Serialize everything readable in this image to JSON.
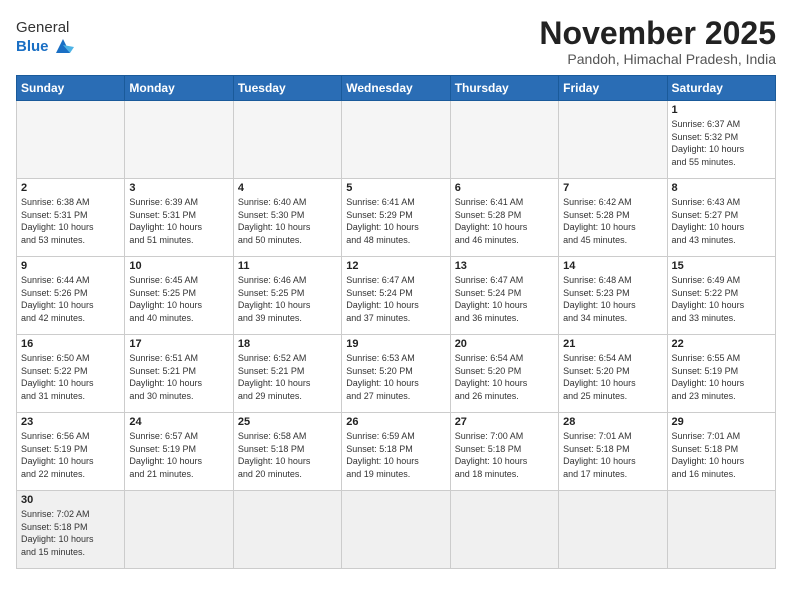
{
  "logo": {
    "text_general": "General",
    "text_blue": "Blue"
  },
  "title": "November 2025",
  "subtitle": "Pandoh, Himachal Pradesh, India",
  "days_of_week": [
    "Sunday",
    "Monday",
    "Tuesday",
    "Wednesday",
    "Thursday",
    "Friday",
    "Saturday"
  ],
  "weeks": [
    [
      {
        "day": "",
        "info": ""
      },
      {
        "day": "",
        "info": ""
      },
      {
        "day": "",
        "info": ""
      },
      {
        "day": "",
        "info": ""
      },
      {
        "day": "",
        "info": ""
      },
      {
        "day": "",
        "info": ""
      },
      {
        "day": "1",
        "info": "Sunrise: 6:37 AM\nSunset: 5:32 PM\nDaylight: 10 hours\nand 55 minutes."
      }
    ],
    [
      {
        "day": "2",
        "info": "Sunrise: 6:38 AM\nSunset: 5:31 PM\nDaylight: 10 hours\nand 53 minutes."
      },
      {
        "day": "3",
        "info": "Sunrise: 6:39 AM\nSunset: 5:31 PM\nDaylight: 10 hours\nand 51 minutes."
      },
      {
        "day": "4",
        "info": "Sunrise: 6:40 AM\nSunset: 5:30 PM\nDaylight: 10 hours\nand 50 minutes."
      },
      {
        "day": "5",
        "info": "Sunrise: 6:41 AM\nSunset: 5:29 PM\nDaylight: 10 hours\nand 48 minutes."
      },
      {
        "day": "6",
        "info": "Sunrise: 6:41 AM\nSunset: 5:28 PM\nDaylight: 10 hours\nand 46 minutes."
      },
      {
        "day": "7",
        "info": "Sunrise: 6:42 AM\nSunset: 5:28 PM\nDaylight: 10 hours\nand 45 minutes."
      },
      {
        "day": "8",
        "info": "Sunrise: 6:43 AM\nSunset: 5:27 PM\nDaylight: 10 hours\nand 43 minutes."
      }
    ],
    [
      {
        "day": "9",
        "info": "Sunrise: 6:44 AM\nSunset: 5:26 PM\nDaylight: 10 hours\nand 42 minutes."
      },
      {
        "day": "10",
        "info": "Sunrise: 6:45 AM\nSunset: 5:25 PM\nDaylight: 10 hours\nand 40 minutes."
      },
      {
        "day": "11",
        "info": "Sunrise: 6:46 AM\nSunset: 5:25 PM\nDaylight: 10 hours\nand 39 minutes."
      },
      {
        "day": "12",
        "info": "Sunrise: 6:47 AM\nSunset: 5:24 PM\nDaylight: 10 hours\nand 37 minutes."
      },
      {
        "day": "13",
        "info": "Sunrise: 6:47 AM\nSunset: 5:24 PM\nDaylight: 10 hours\nand 36 minutes."
      },
      {
        "day": "14",
        "info": "Sunrise: 6:48 AM\nSunset: 5:23 PM\nDaylight: 10 hours\nand 34 minutes."
      },
      {
        "day": "15",
        "info": "Sunrise: 6:49 AM\nSunset: 5:22 PM\nDaylight: 10 hours\nand 33 minutes."
      }
    ],
    [
      {
        "day": "16",
        "info": "Sunrise: 6:50 AM\nSunset: 5:22 PM\nDaylight: 10 hours\nand 31 minutes."
      },
      {
        "day": "17",
        "info": "Sunrise: 6:51 AM\nSunset: 5:21 PM\nDaylight: 10 hours\nand 30 minutes."
      },
      {
        "day": "18",
        "info": "Sunrise: 6:52 AM\nSunset: 5:21 PM\nDaylight: 10 hours\nand 29 minutes."
      },
      {
        "day": "19",
        "info": "Sunrise: 6:53 AM\nSunset: 5:20 PM\nDaylight: 10 hours\nand 27 minutes."
      },
      {
        "day": "20",
        "info": "Sunrise: 6:54 AM\nSunset: 5:20 PM\nDaylight: 10 hours\nand 26 minutes."
      },
      {
        "day": "21",
        "info": "Sunrise: 6:54 AM\nSunset: 5:20 PM\nDaylight: 10 hours\nand 25 minutes."
      },
      {
        "day": "22",
        "info": "Sunrise: 6:55 AM\nSunset: 5:19 PM\nDaylight: 10 hours\nand 23 minutes."
      }
    ],
    [
      {
        "day": "23",
        "info": "Sunrise: 6:56 AM\nSunset: 5:19 PM\nDaylight: 10 hours\nand 22 minutes."
      },
      {
        "day": "24",
        "info": "Sunrise: 6:57 AM\nSunset: 5:19 PM\nDaylight: 10 hours\nand 21 minutes."
      },
      {
        "day": "25",
        "info": "Sunrise: 6:58 AM\nSunset: 5:18 PM\nDaylight: 10 hours\nand 20 minutes."
      },
      {
        "day": "26",
        "info": "Sunrise: 6:59 AM\nSunset: 5:18 PM\nDaylight: 10 hours\nand 19 minutes."
      },
      {
        "day": "27",
        "info": "Sunrise: 7:00 AM\nSunset: 5:18 PM\nDaylight: 10 hours\nand 18 minutes."
      },
      {
        "day": "28",
        "info": "Sunrise: 7:01 AM\nSunset: 5:18 PM\nDaylight: 10 hours\nand 17 minutes."
      },
      {
        "day": "29",
        "info": "Sunrise: 7:01 AM\nSunset: 5:18 PM\nDaylight: 10 hours\nand 16 minutes."
      }
    ],
    [
      {
        "day": "30",
        "info": "Sunrise: 7:02 AM\nSunset: 5:18 PM\nDaylight: 10 hours\nand 15 minutes."
      },
      {
        "day": "",
        "info": ""
      },
      {
        "day": "",
        "info": ""
      },
      {
        "day": "",
        "info": ""
      },
      {
        "day": "",
        "info": ""
      },
      {
        "day": "",
        "info": ""
      },
      {
        "day": "",
        "info": ""
      }
    ]
  ]
}
